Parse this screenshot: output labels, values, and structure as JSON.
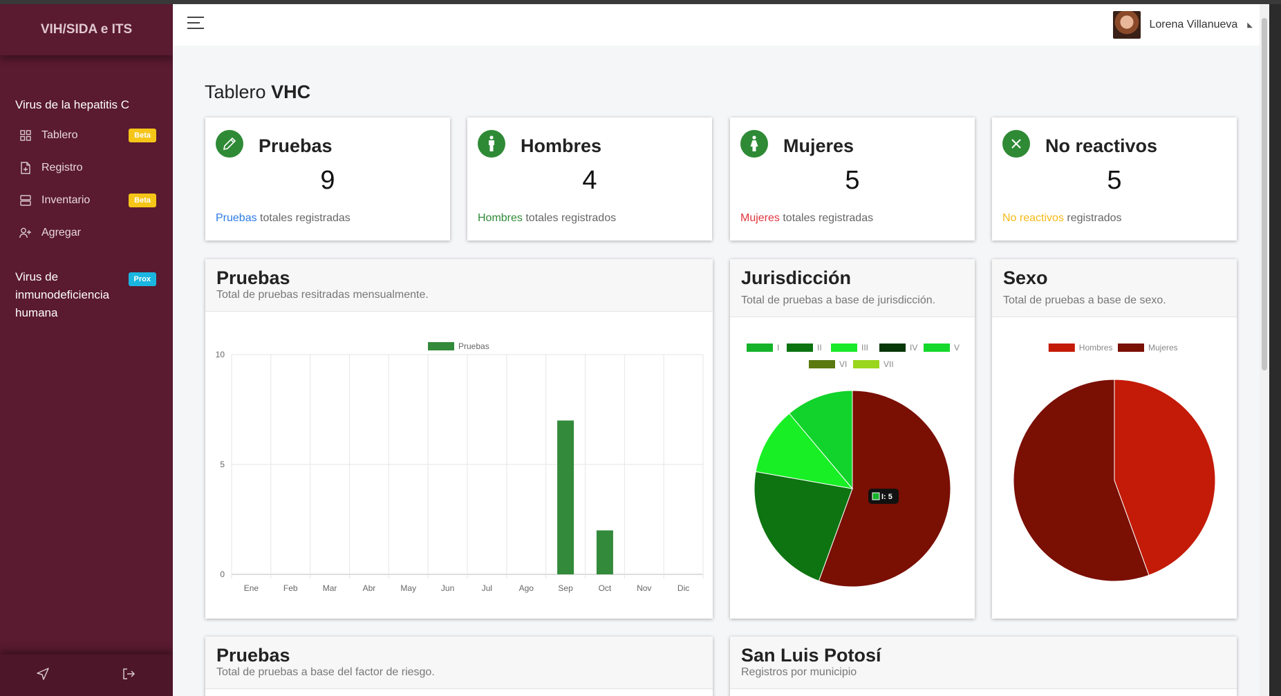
{
  "sidebar": {
    "brand": "VIH/SIDA e ITS",
    "section1_title": "Virus de la hepatitis C",
    "items": [
      {
        "label": "Tablero",
        "badge": "Beta",
        "icon": "grid-icon"
      },
      {
        "label": "Registro",
        "badge": "",
        "icon": "file-plus-icon"
      },
      {
        "label": "Inventario",
        "badge": "Beta",
        "icon": "server-icon"
      },
      {
        "label": "Agregar",
        "badge": "",
        "icon": "user-plus-icon"
      }
    ],
    "section2_title_l1": "Virus de",
    "section2_title_l2": "inmunodeficiencia",
    "section2_title_l3": "humana",
    "section2_badge": "Prox",
    "colors": {
      "bg": "#5a1a30",
      "beta": "#f5c518",
      "prox": "#1ab6e0"
    }
  },
  "topbar": {
    "user_name": "Lorena Villanueva"
  },
  "page": {
    "title_prefix": "Tablero",
    "title_bold": "VHC"
  },
  "stats": [
    {
      "label": "Pruebas",
      "value": "9",
      "desc_hl": "Pruebas",
      "desc_rest": " totales registradas",
      "hl_color": "#2a7ae4",
      "icon": "pencil-icon"
    },
    {
      "label": "Hombres",
      "value": "4",
      "desc_hl": "Hombres",
      "desc_rest": " totales registrados",
      "hl_color": "#2f8a36",
      "icon": "male-icon"
    },
    {
      "label": "Mujeres",
      "value": "5",
      "desc_hl": "Mujeres",
      "desc_rest": " totales registradas",
      "hl_color": "#e0343d",
      "icon": "female-icon"
    },
    {
      "label": "No reactivos",
      "value": "5",
      "desc_hl": "No reactivos",
      "desc_rest": " registrados",
      "hl_color": "#f5b915",
      "icon": "close-icon"
    }
  ],
  "panels": {
    "monthly": {
      "title": "Pruebas",
      "subtitle": "Total de pruebas resitradas mensualmente."
    },
    "jurisdiccion": {
      "title": "Jurisdicción",
      "subtitle": "Total de pruebas a base de jurisdicción.",
      "tooltip": "I: 5"
    },
    "sexo": {
      "title": "Sexo",
      "subtitle": "Total de pruebas a base de sexo."
    },
    "riesgo": {
      "title": "Pruebas",
      "subtitle": "Total de pruebas a base del factor de riesgo."
    },
    "slp": {
      "title": "San Luis Potosí",
      "subtitle": "Registros por municipio"
    }
  },
  "chart_data": [
    {
      "type": "bar",
      "categories": [
        "Ene",
        "Feb",
        "Mar",
        "Abr",
        "May",
        "Jun",
        "Jul",
        "Ago",
        "Sep",
        "Oct",
        "Nov",
        "Dic"
      ],
      "series": [
        {
          "name": "Pruebas",
          "values": [
            0,
            0,
            0,
            0,
            0,
            0,
            0,
            0,
            7,
            2,
            0,
            0
          ],
          "color": "#338a3a"
        }
      ],
      "ylim": [
        0,
        10
      ],
      "yticks": [
        0,
        5,
        10
      ],
      "grid": true,
      "legend": "top"
    },
    {
      "type": "pie",
      "labels": [
        "I",
        "II",
        "III",
        "IV",
        "V",
        "VI",
        "VII"
      ],
      "values": [
        5,
        2,
        1,
        0,
        1,
        0,
        0
      ],
      "colors": [
        "#15b32a",
        "#0b7310",
        "#19ea2a",
        "#073608",
        "#14d82a",
        "#5a7a10",
        "#9ad61e"
      ],
      "slice_colors": [
        "#7a0f04",
        "#0e7411",
        "#18ef25",
        "#073608",
        "#12d32b",
        "#5a7a10",
        "#9ad61e"
      ],
      "legend": "top"
    },
    {
      "type": "pie",
      "labels": [
        "Hombres",
        "Mujeres"
      ],
      "values": [
        4,
        5
      ],
      "colors": [
        "#c41a08",
        "#7a0f04"
      ],
      "legend": "top"
    }
  ]
}
